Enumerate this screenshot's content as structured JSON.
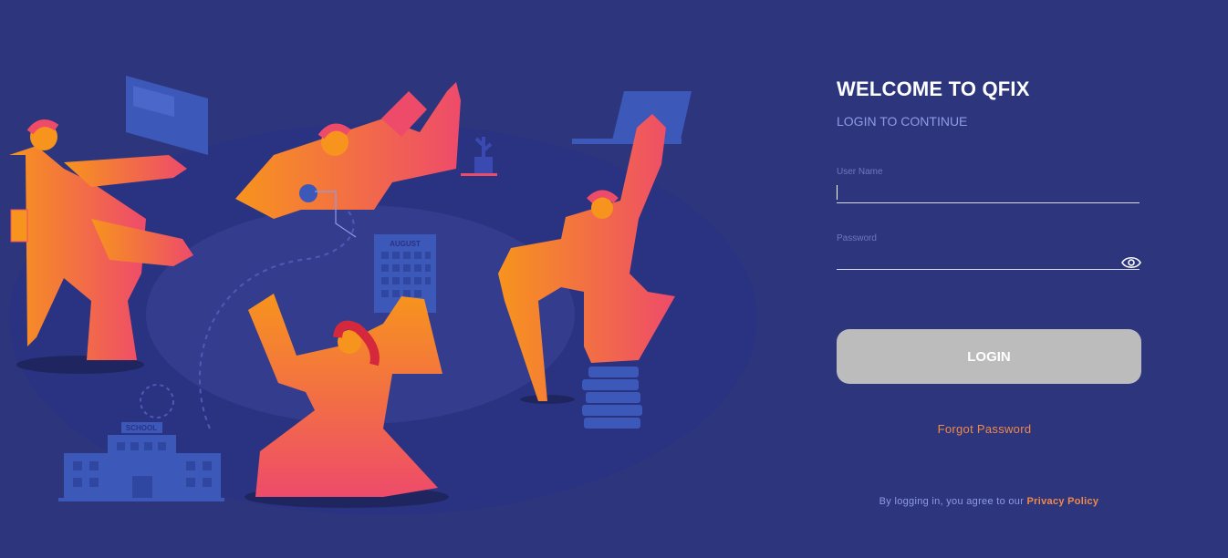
{
  "welcome": {
    "title": "WELCOME TO QFIX",
    "subtitle": "LOGIN TO CONTINUE"
  },
  "form": {
    "username_label": "User Name",
    "username_value": "",
    "password_label": "Password",
    "password_value": "",
    "login_label": "LOGIN",
    "forgot_label": "Forgot Password"
  },
  "footer": {
    "terms_prefix": "By logging in, you agree to our",
    "privacy_label": "Privacy Policy"
  },
  "illustration": {
    "calendar_month": "AUGUST",
    "building_sign": "SCHOOL"
  },
  "icons": {
    "password_toggle": "eye-icon"
  },
  "colors": {
    "background": "#2d357d",
    "accent": "#f08a4b",
    "muted_text": "#8f9be6",
    "button_disabled": "#bcbcbc",
    "figure_orange": "#f7941d",
    "figure_pink": "#ee4b6a"
  }
}
